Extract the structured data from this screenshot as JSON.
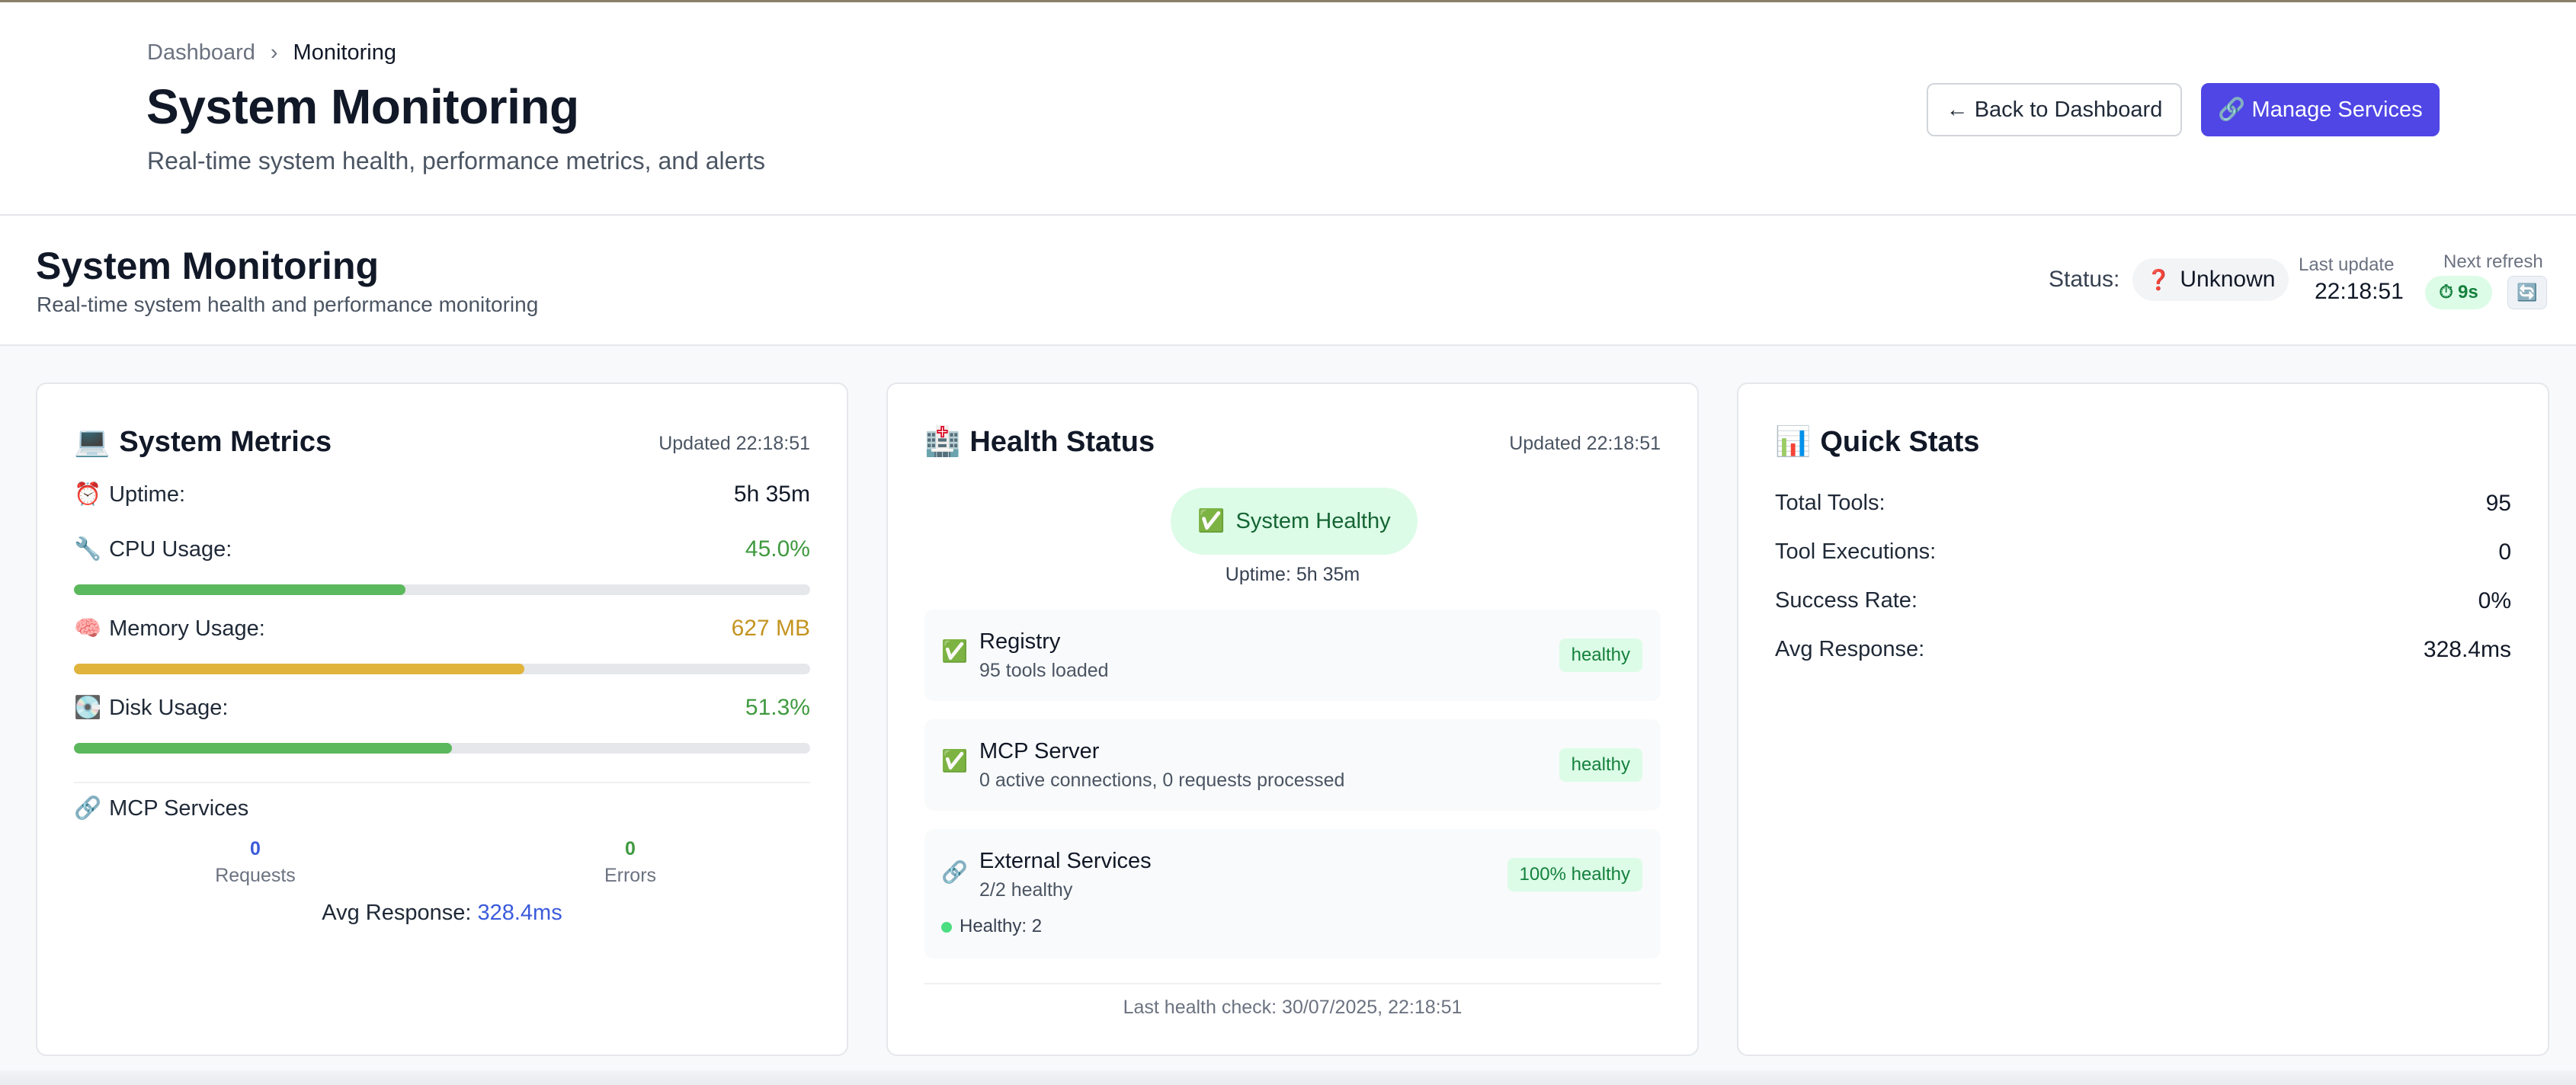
{
  "breadcrumb": {
    "home": "Dashboard",
    "separator": "›",
    "current": "Monitoring"
  },
  "page": {
    "title": "System Monitoring",
    "subtitle": "Real-time system health, performance metrics, and alerts",
    "back_button": "← Back to Dashboard",
    "manage_button": "🔗 Manage Services"
  },
  "monitor": {
    "title": "System Monitoring",
    "subtitle": "Real-time system health and performance monitoring",
    "status_label": "Status:",
    "status_icon": "❓",
    "status_value": "Unknown",
    "last_update_label": "Last update",
    "last_update_value": "22:18:51",
    "next_refresh_label": "Next refresh",
    "next_refresh_icon": "⏱",
    "next_refresh_value": "9s",
    "refresh_icon": "🔄"
  },
  "metrics": {
    "icon": "💻",
    "title": "System Metrics",
    "updated": "Updated 22:18:51",
    "uptime_icon": "⏰",
    "uptime_label": "Uptime:",
    "uptime_value": "5h 35m",
    "cpu_icon": "🔧",
    "cpu_label": "CPU Usage:",
    "cpu_value": "45.0%",
    "cpu_fraction": 0.45,
    "memory_icon": "🧠",
    "memory_label": "Memory Usage:",
    "memory_value": "627 MB",
    "memory_fraction": 0.612,
    "disk_icon": "💽",
    "disk_label": "Disk Usage:",
    "disk_value": "51.3%",
    "disk_fraction": 0.513,
    "mcp_icon": "🔗",
    "mcp_title": "MCP Services",
    "requests_value": "0",
    "requests_label": "Requests",
    "errors_value": "0",
    "errors_label": "Errors",
    "avg_response_label": "Avg Response:",
    "avg_response_value": "328.4ms",
    "colors": {
      "cpu": "#5cb85c",
      "memory": "#e0b33a",
      "disk": "#5cb85c"
    }
  },
  "health": {
    "icon": "🏥",
    "title": "Health Status",
    "updated": "Updated 22:18:51",
    "overall_icon": "✅",
    "overall": "System Healthy",
    "uptime": "Uptime: 5h 35m",
    "services": [
      {
        "icon": "✅",
        "name": "Registry",
        "desc": "95 tools loaded",
        "badge": "healthy"
      },
      {
        "icon": "✅",
        "name": "MCP Server",
        "desc": "0 active connections, 0 requests processed",
        "badge": "healthy"
      },
      {
        "icon": "🔗",
        "name": "External Services",
        "desc": "2/2 healthy",
        "badge": "100% healthy",
        "sub": "Healthy: 2"
      }
    ],
    "last_check": "Last health check: 30/07/2025, 22:18:51"
  },
  "quick_stats": {
    "icon": "📊",
    "title": "Quick Stats",
    "rows": [
      {
        "label": "Total Tools:",
        "value": "95"
      },
      {
        "label": "Tool Executions:",
        "value": "0"
      },
      {
        "label": "Success Rate:",
        "value": "0%"
      },
      {
        "label": "Avg Response:",
        "value": "328.4ms"
      }
    ]
  }
}
